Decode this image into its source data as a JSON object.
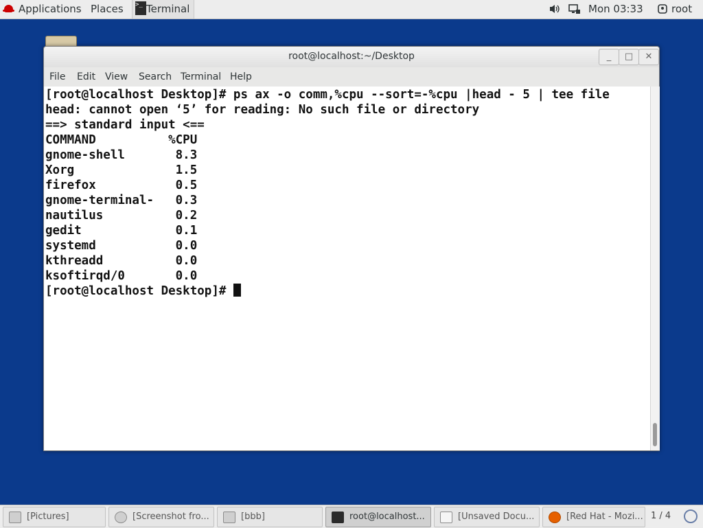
{
  "topbar": {
    "applications": "Applications",
    "places": "Places",
    "active_app": "Terminal",
    "clock": "Mon 03:33",
    "user": "root"
  },
  "window": {
    "title": "root@localhost:~/Desktop",
    "minimize": "_",
    "maximize": "□",
    "close": "✕",
    "menu": [
      "File",
      "Edit",
      "View",
      "Search",
      "Terminal",
      "Help"
    ]
  },
  "terminal": {
    "lines": [
      "[root@localhost Desktop]# ps ax -o comm,%cpu --sort=-%cpu |head - 5 | tee file",
      "head: cannot open ‘5’ for reading: No such file or directory",
      "==> standard input <==",
      "COMMAND          %CPU",
      "gnome-shell       8.3",
      "Xorg              1.5",
      "firefox           0.5",
      "gnome-terminal-   0.3",
      "nautilus          0.2",
      "gedit             0.1",
      "systemd           0.0",
      "kthreadd          0.0",
      "ksoftirqd/0       0.0",
      "[root@localhost Desktop]# "
    ]
  },
  "taskbar": {
    "tasks": [
      {
        "label": "[Pictures]",
        "icon": "folder-icon"
      },
      {
        "label": "[Screenshot fro...",
        "icon": "screenshot-icon"
      },
      {
        "label": "[bbb]",
        "icon": "folder-icon"
      },
      {
        "label": "root@localhost...",
        "icon": "terminal-icon"
      },
      {
        "label": "[Unsaved Docu...",
        "icon": "text-editor-icon"
      },
      {
        "label": "[Red Hat - Mozi...",
        "icon": "firefox-icon"
      }
    ],
    "pager": "1 / 4"
  },
  "colors": {
    "desktop": "#0b3a8c",
    "panel": "#ededed",
    "terminal_bg": "#ffffff",
    "terminal_fg": "#111111"
  }
}
